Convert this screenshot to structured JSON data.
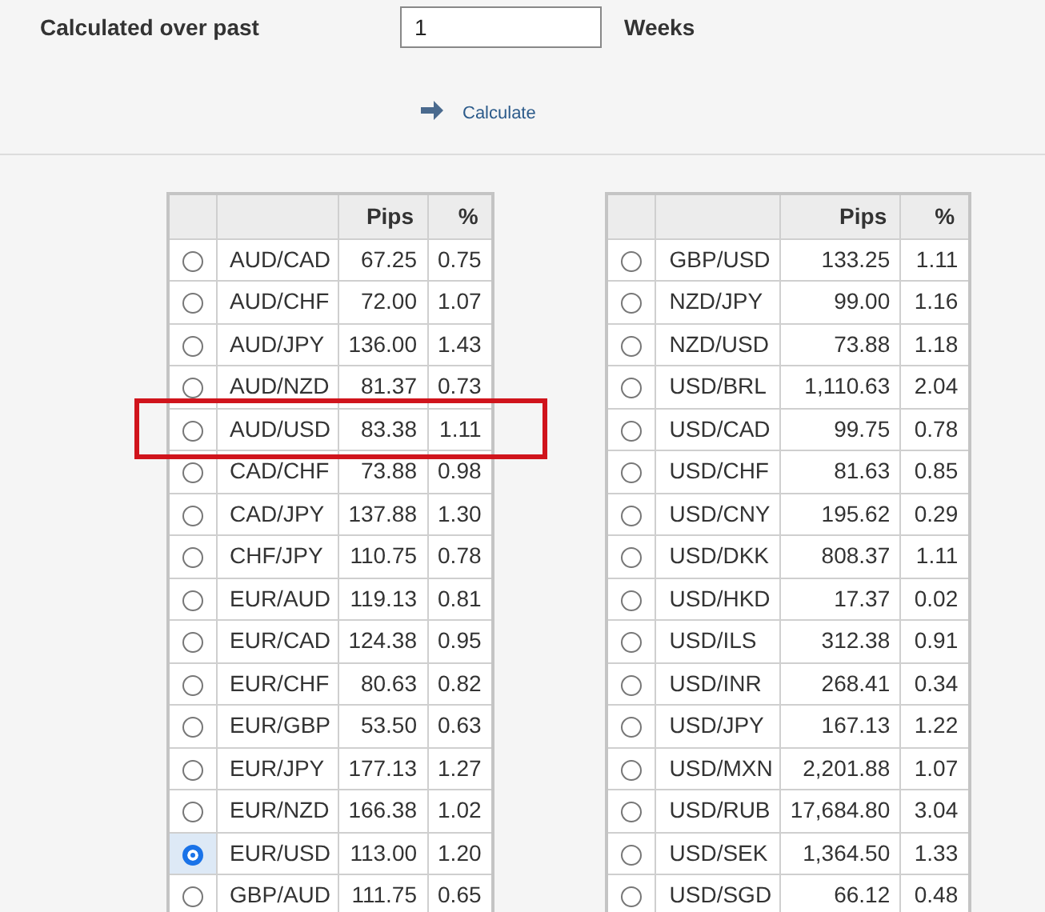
{
  "form": {
    "label": "Calculated over past",
    "weeks_value": "1",
    "unit": "Weeks",
    "action": "Calculate"
  },
  "tables": [
    {
      "columns": [
        "Pips",
        "%"
      ],
      "rows": [
        {
          "pair": "AUD/CAD",
          "pips": "67.25",
          "percent": "0.75",
          "selected": false
        },
        {
          "pair": "AUD/CHF",
          "pips": "72.00",
          "percent": "1.07",
          "selected": false
        },
        {
          "pair": "AUD/JPY",
          "pips": "136.00",
          "percent": "1.43",
          "selected": false
        },
        {
          "pair": "AUD/NZD",
          "pips": "81.37",
          "percent": "0.73",
          "selected": false
        },
        {
          "pair": "AUD/USD",
          "pips": "83.38",
          "percent": "1.11",
          "selected": false
        },
        {
          "pair": "CAD/CHF",
          "pips": "73.88",
          "percent": "0.98",
          "selected": false
        },
        {
          "pair": "CAD/JPY",
          "pips": "137.88",
          "percent": "1.30",
          "selected": false
        },
        {
          "pair": "CHF/JPY",
          "pips": "110.75",
          "percent": "0.78",
          "selected": false
        },
        {
          "pair": "EUR/AUD",
          "pips": "119.13",
          "percent": "0.81",
          "selected": false
        },
        {
          "pair": "EUR/CAD",
          "pips": "124.38",
          "percent": "0.95",
          "selected": false
        },
        {
          "pair": "EUR/CHF",
          "pips": "80.63",
          "percent": "0.82",
          "selected": false
        },
        {
          "pair": "EUR/GBP",
          "pips": "53.50",
          "percent": "0.63",
          "selected": false
        },
        {
          "pair": "EUR/JPY",
          "pips": "177.13",
          "percent": "1.27",
          "selected": false
        },
        {
          "pair": "EUR/NZD",
          "pips": "166.38",
          "percent": "1.02",
          "selected": false
        },
        {
          "pair": "EUR/USD",
          "pips": "113.00",
          "percent": "1.20",
          "selected": true
        },
        {
          "pair": "GBP/AUD",
          "pips": "111.75",
          "percent": "0.65",
          "selected": false
        }
      ]
    },
    {
      "columns": [
        "Pips",
        "%"
      ],
      "rows": [
        {
          "pair": "GBP/USD",
          "pips": "133.25",
          "percent": "1.11",
          "selected": false
        },
        {
          "pair": "NZD/JPY",
          "pips": "99.00",
          "percent": "1.16",
          "selected": false
        },
        {
          "pair": "NZD/USD",
          "pips": "73.88",
          "percent": "1.18",
          "selected": false
        },
        {
          "pair": "USD/BRL",
          "pips": "1,110.63",
          "percent": "2.04",
          "selected": false
        },
        {
          "pair": "USD/CAD",
          "pips": "99.75",
          "percent": "0.78",
          "selected": false
        },
        {
          "pair": "USD/CHF",
          "pips": "81.63",
          "percent": "0.85",
          "selected": false
        },
        {
          "pair": "USD/CNY",
          "pips": "195.62",
          "percent": "0.29",
          "selected": false
        },
        {
          "pair": "USD/DKK",
          "pips": "808.37",
          "percent": "1.11",
          "selected": false
        },
        {
          "pair": "USD/HKD",
          "pips": "17.37",
          "percent": "0.02",
          "selected": false
        },
        {
          "pair": "USD/ILS",
          "pips": "312.38",
          "percent": "0.91",
          "selected": false
        },
        {
          "pair": "USD/INR",
          "pips": "268.41",
          "percent": "0.34",
          "selected": false
        },
        {
          "pair": "USD/JPY",
          "pips": "167.13",
          "percent": "1.22",
          "selected": false
        },
        {
          "pair": "USD/MXN",
          "pips": "2,201.88",
          "percent": "1.07",
          "selected": false
        },
        {
          "pair": "USD/RUB",
          "pips": "17,684.80",
          "percent": "3.04",
          "selected": false
        },
        {
          "pair": "USD/SEK",
          "pips": "1,364.50",
          "percent": "1.33",
          "selected": false
        },
        {
          "pair": "USD/SGD",
          "pips": "66.12",
          "percent": "0.48",
          "selected": false
        }
      ]
    }
  ]
}
